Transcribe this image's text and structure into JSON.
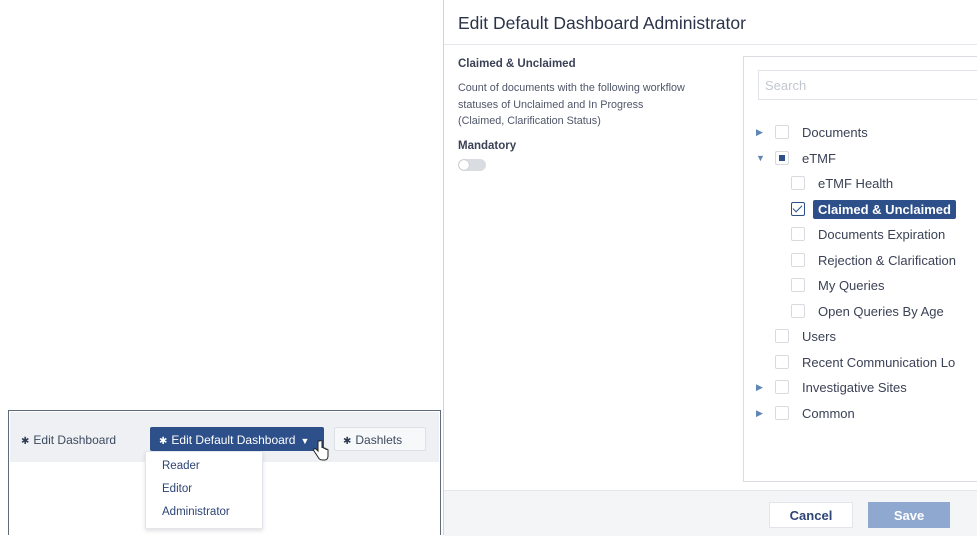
{
  "toolbar": {
    "edit_dashboard_label": "Edit Dashboard",
    "edit_default_label": "Edit Default Dashboard",
    "dashlets_label": "Dashlets",
    "menu_items": [
      "Reader",
      "Editor",
      "Administrator"
    ],
    "icons": {
      "gear": "gear-icon",
      "caret": "caret-down-icon",
      "cursor": "hand-cursor"
    }
  },
  "modal": {
    "title": "Edit Default Dashboard Administrator",
    "dashlet": {
      "name": "Claimed & Unclaimed",
      "description": "Count of documents with the following workflow statuses of Unclaimed and In Progress (Claimed, Clarification Status)",
      "mandatory_label": "Mandatory",
      "mandatory_on": false
    },
    "search_placeholder": "Search",
    "tree": [
      {
        "label": "Documents",
        "state": "unchecked",
        "expander": "collapsed"
      },
      {
        "label": "eTMF",
        "state": "partial",
        "expander": "expanded"
      },
      {
        "label": "eTMF Health",
        "state": "unchecked",
        "expander": "none"
      },
      {
        "label": "Claimed & Unclaimed",
        "state": "checked",
        "expander": "none",
        "selected": true
      },
      {
        "label": "Documents Expiration",
        "state": "unchecked",
        "expander": "none"
      },
      {
        "label": "Rejection & Clarification",
        "state": "unchecked",
        "expander": "none"
      },
      {
        "label": "My Queries",
        "state": "unchecked",
        "expander": "none"
      },
      {
        "label": "Open Queries By Age",
        "state": "unchecked",
        "expander": "none"
      },
      {
        "label": "Users",
        "state": "unchecked",
        "expander": "none"
      },
      {
        "label": "Recent Communication Lo",
        "state": "unchecked",
        "expander": "none"
      },
      {
        "label": "Investigative Sites",
        "state": "unchecked",
        "expander": "collapsed"
      },
      {
        "label": "Common",
        "state": "unchecked",
        "expander": "collapsed"
      }
    ],
    "footer": {
      "cancel_label": "Cancel",
      "save_label": "Save"
    }
  },
  "colors": {
    "accent": "#2d4f8a",
    "save_disabled": "#8fa8cf",
    "footer_bg": "#f4f5f7"
  }
}
